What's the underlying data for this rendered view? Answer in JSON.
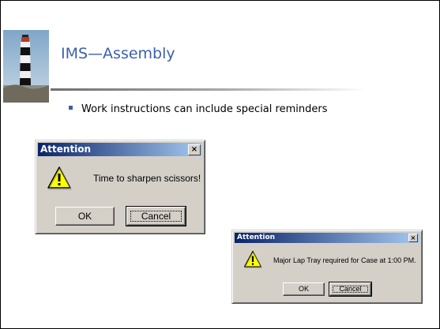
{
  "slide": {
    "title": "IMS—Assembly",
    "bullet": "Work instructions can include special reminders"
  },
  "dialog_small": {
    "title": "Attention",
    "close_label": "×",
    "message": "Time to sharpen scissors!",
    "ok_label": "OK",
    "cancel_label": "Cancel"
  },
  "dialog_large": {
    "title": "Attention",
    "close_label": "×",
    "message": "Major Lap Tray required for Case at 1:00 PM.",
    "ok_label": "OK",
    "cancel_label": "Cancel"
  },
  "colors": {
    "title": "#3b5fb0",
    "titlebar_start": "#0a246a",
    "titlebar_end": "#a6caf0",
    "dialog_face": "#d4d0c8",
    "warning_fill": "#ffff00"
  },
  "icons": {
    "decoration": "lighthouse-image",
    "warning": "warning-icon",
    "close": "close-icon"
  }
}
